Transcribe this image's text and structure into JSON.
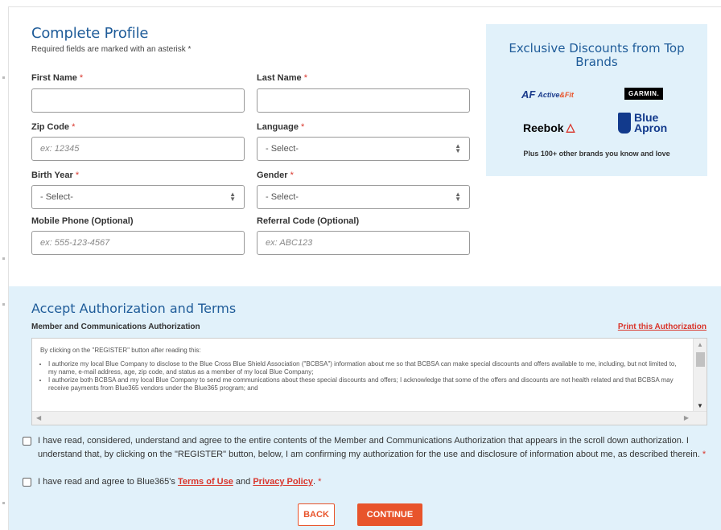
{
  "profile": {
    "title": "Complete Profile",
    "required_note": "Required fields are marked with an asterisk *",
    "asterisk": "*",
    "fields": {
      "first_name": {
        "label": "First Name",
        "value": ""
      },
      "last_name": {
        "label": "Last Name",
        "value": ""
      },
      "zip_code": {
        "label": "Zip Code",
        "placeholder": "ex: 12345"
      },
      "language": {
        "label": "Language",
        "selected": "- Select-"
      },
      "birth_year": {
        "label": "Birth Year",
        "selected": "- Select-"
      },
      "gender": {
        "label": "Gender",
        "selected": "- Select-"
      },
      "mobile_phone": {
        "label": "Mobile Phone (Optional)",
        "placeholder": "ex: 555-123-4567"
      },
      "referral_code": {
        "label": "Referral Code (Optional)",
        "placeholder": "ex: ABC123"
      }
    }
  },
  "discounts": {
    "title": "Exclusive Discounts from Top Brands",
    "brands": {
      "active": "Active",
      "active_fit": "&Fit",
      "garmin": "GARMIN.",
      "reebok": "Reebok",
      "blue_apron_line1": "Blue",
      "blue_apron_line2": "Apron"
    },
    "note": "Plus 100+ other brands you know and love"
  },
  "auth": {
    "title": "Accept Authorization and Terms",
    "subtitle": "Member and Communications Authorization",
    "print_link": "Print this Authorization",
    "intro": "By clicking on the \"REGISTER\" button after reading this:",
    "bullets": [
      "I authorize my local Blue Company to disclose to the Blue Cross Blue Shield Association (\"BCBSA\") information about me so that BCBSA can make special discounts and offers available to me, including, but not limited to, my name, e-mail address, age, zip code, and status as a member of my local Blue Company;",
      "I authorize both BCBSA and my local Blue Company to send me communications about these special discounts and offers; I acknowledge that some of the offers and discounts are not health related and that BCBSA may receive payments from Blue365 vendors under the Blue365 program; and"
    ],
    "check1": "I have read, considered, understand and agree to the entire contents of the Member and Communications Authorization that appears in the scroll down authorization. I understand that, by clicking on the \"REGISTER\" button, below, I am confirming my authorization for the use and disclosure of information about me, as described therein.",
    "check2_prefix": "I have read and agree to Blue365's",
    "terms_link": "Terms of Use",
    "and": "and",
    "privacy_link": "Privacy Policy",
    "asterisk": "*"
  },
  "buttons": {
    "back": "BACK",
    "continue": "CONTINUE"
  },
  "colors": {
    "title_blue": "#1f5c99",
    "accent_orange": "#e8542b",
    "panel_bg": "#e1f1fa"
  }
}
